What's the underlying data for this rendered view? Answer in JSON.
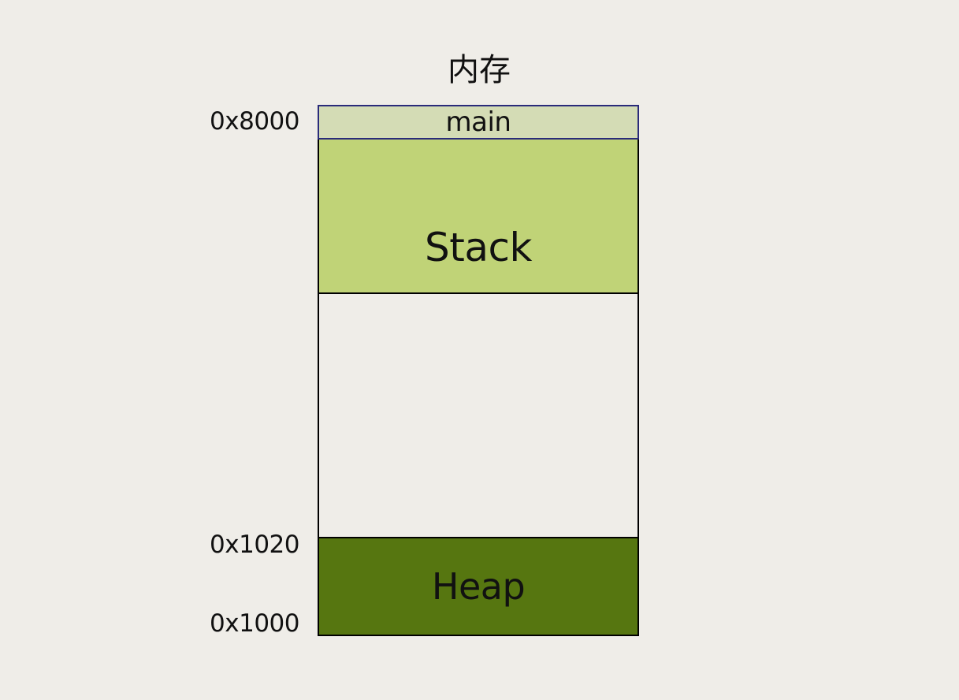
{
  "diagram": {
    "title": "内存",
    "segments": {
      "main": "main",
      "stack": "Stack",
      "heap": "Heap"
    },
    "addresses": {
      "top": "0x8000",
      "heap_top": "0x1020",
      "bottom": "0x1000"
    },
    "colors": {
      "background": "#efede8",
      "main_fill": "#d4dcb5",
      "main_border": "#2a2b7a",
      "stack_fill": "#c0d377",
      "heap_fill": "#567610",
      "free_fill": "#efede8"
    }
  }
}
